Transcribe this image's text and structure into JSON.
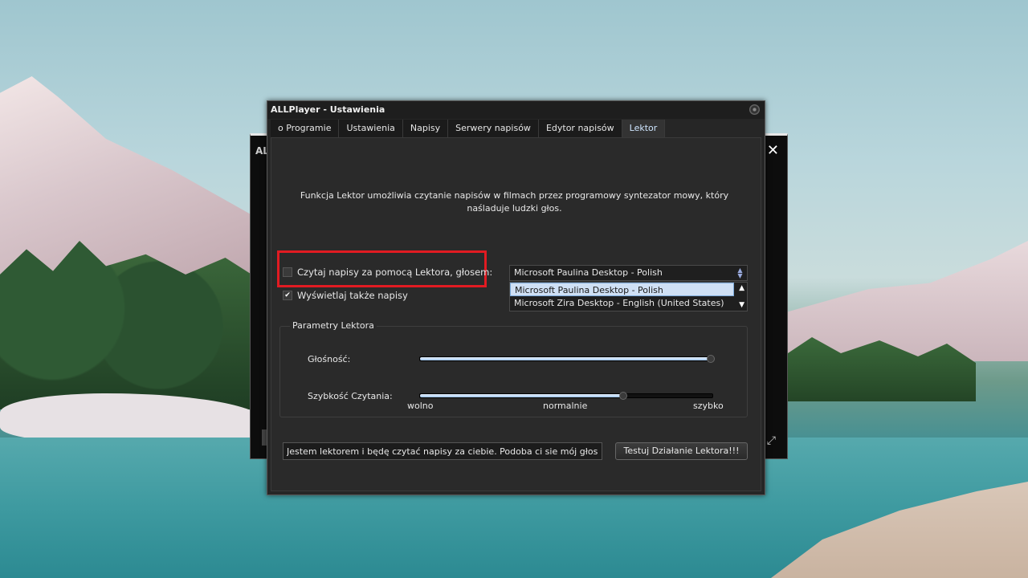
{
  "background_player": {
    "title": "ALL",
    "close_glyph": "✕"
  },
  "dialog": {
    "title": "ALLPlayer - Ustawienia",
    "tabs": [
      {
        "label": "o Programie",
        "active": false
      },
      {
        "label": "Ustawienia",
        "active": false
      },
      {
        "label": "Napisy",
        "active": false
      },
      {
        "label": "Serwery napisów",
        "active": false
      },
      {
        "label": "Edytor napisów",
        "active": false
      },
      {
        "label": "Lektor",
        "active": true
      }
    ]
  },
  "lektor": {
    "description": "Funkcja Lektor umożliwia czytanie napisów w filmach przez programowy syntezator mowy, który naśladuje ludzki głos.",
    "read_checkbox": {
      "label": "Czytaj napisy za pomocą Lektora, głosem:",
      "checked": false
    },
    "show_subtitles_checkbox": {
      "label": "Wyświetlaj także napisy",
      "checked": true
    },
    "voice_select": {
      "selected": "Microsoft Paulina Desktop - Polish",
      "options": [
        "Microsoft Paulina Desktop - Polish",
        "Microsoft Zira Desktop - English (United States)"
      ]
    },
    "params": {
      "title": "Parametry Lektora",
      "volume": {
        "label": "Głośność:",
        "value_fraction": 0.99
      },
      "speed": {
        "label": "Szybkość Czytania:",
        "value_fraction": 0.69,
        "min_label": "wolno",
        "mid_label": "normalnie",
        "max_label": "szybko"
      }
    },
    "test_text": "Jestem lektorem i będę czytać napisy za ciebie. Podoba ci sie mój głos?",
    "test_button": "Testuj Działanie Lektora!!!"
  },
  "colors": {
    "highlight": "#e11b22",
    "active_tab_text": "#cfe6ff",
    "selection_bg": "#cfe0f5"
  }
}
